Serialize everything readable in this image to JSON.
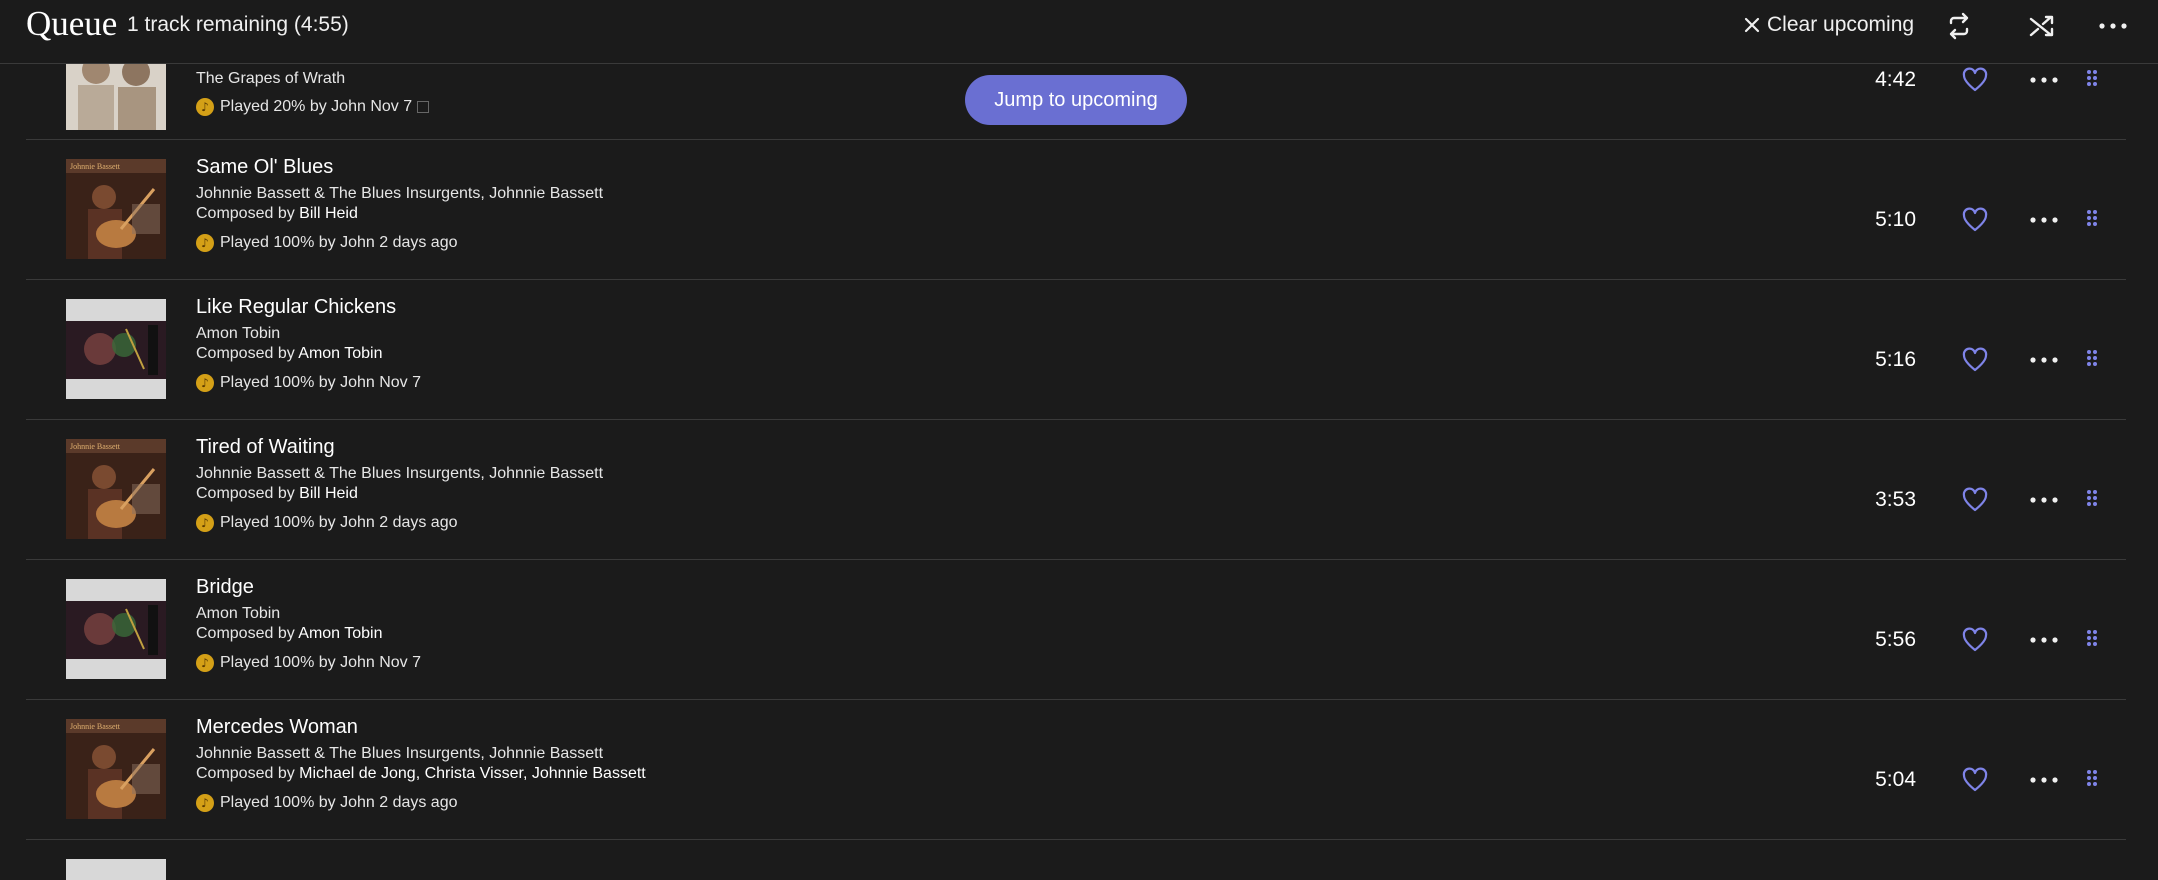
{
  "header": {
    "title": "Queue",
    "subtitle": "1 track remaining (4:55)",
    "clear_label": "Clear upcoming",
    "accent": "#6a6fd2"
  },
  "jump_button": "Jump to upcoming",
  "tracks": [
    {
      "title": "",
      "artist_line": "The Grapes of Wrath",
      "composed_prefix": "",
      "composers": "",
      "played": "Played 20% by John Nov 7",
      "duration": "4:42",
      "cover": "band-photo"
    },
    {
      "title": "Same Ol' Blues",
      "artist_line": "Johnnie Bassett & The Blues Insurgents, Johnnie Bassett",
      "composed_prefix": "Composed by ",
      "composers": "Bill Heid",
      "played": "Played 100% by John 2 days ago",
      "duration": "5:10",
      "cover": "guitar-photo"
    },
    {
      "title": "Like Regular Chickens",
      "artist_line": "Amon Tobin",
      "composed_prefix": "Composed by ",
      "composers": "Amon Tobin",
      "played": "Played 100% by John Nov 7",
      "duration": "5:16",
      "cover": "electronic-art"
    },
    {
      "title": "Tired of Waiting",
      "artist_line": "Johnnie Bassett & The Blues Insurgents, Johnnie Bassett",
      "composed_prefix": "Composed by ",
      "composers": "Bill Heid",
      "played": "Played 100% by John 2 days ago",
      "duration": "3:53",
      "cover": "guitar-photo"
    },
    {
      "title": "Bridge",
      "artist_line": "Amon Tobin",
      "composed_prefix": "Composed by ",
      "composers": "Amon Tobin",
      "played": "Played 100% by John Nov 7",
      "duration": "5:56",
      "cover": "electronic-art"
    },
    {
      "title": "Mercedes Woman",
      "artist_line": "Johnnie Bassett & The Blues Insurgents, Johnnie Bassett",
      "composed_prefix": "Composed by ",
      "composers": "Michael de Jong, Christa Visser, Johnnie Bassett",
      "played": "Played 100% by John 2 days ago",
      "duration": "5:04",
      "cover": "guitar-photo"
    }
  ]
}
